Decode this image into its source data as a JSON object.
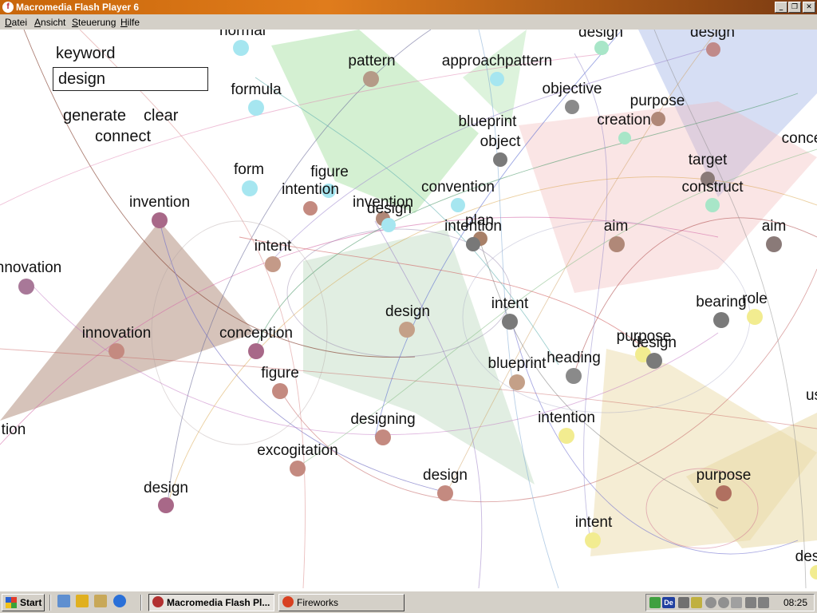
{
  "window": {
    "title": "Macromedia Flash Player 6"
  },
  "menu": [
    "Datei",
    "Ansicht",
    "Steuerung",
    "Hilfe"
  ],
  "controls": {
    "keyword_label": "keyword",
    "keyword_value": "design",
    "generate": "generate",
    "clear": "clear",
    "connect": "connect"
  },
  "words": [
    "normal",
    "design",
    "design",
    "keyword",
    "pattern",
    "approachpattern",
    "formula",
    "objective",
    "purpose",
    "blueprint",
    "creation",
    "object",
    "target",
    "conce",
    "form",
    "figure",
    "intention",
    "convention",
    "construct",
    "invention",
    "invention",
    "design",
    "plan",
    "intention",
    "aim",
    "aim",
    "intent",
    "nnovation",
    "design",
    "intent",
    "bearing",
    "role",
    "innovation",
    "conception",
    "purpose",
    "design",
    "heading",
    "blueprint",
    "figure",
    "us",
    "designing",
    "intention",
    "tion",
    "excogitation",
    "design",
    "purpose",
    "design",
    "intent",
    "des"
  ],
  "taskbar": {
    "start": "Start",
    "tasks": [
      "Macromedia Flash Pl...",
      "Fireworks"
    ],
    "clock": "08:25"
  }
}
